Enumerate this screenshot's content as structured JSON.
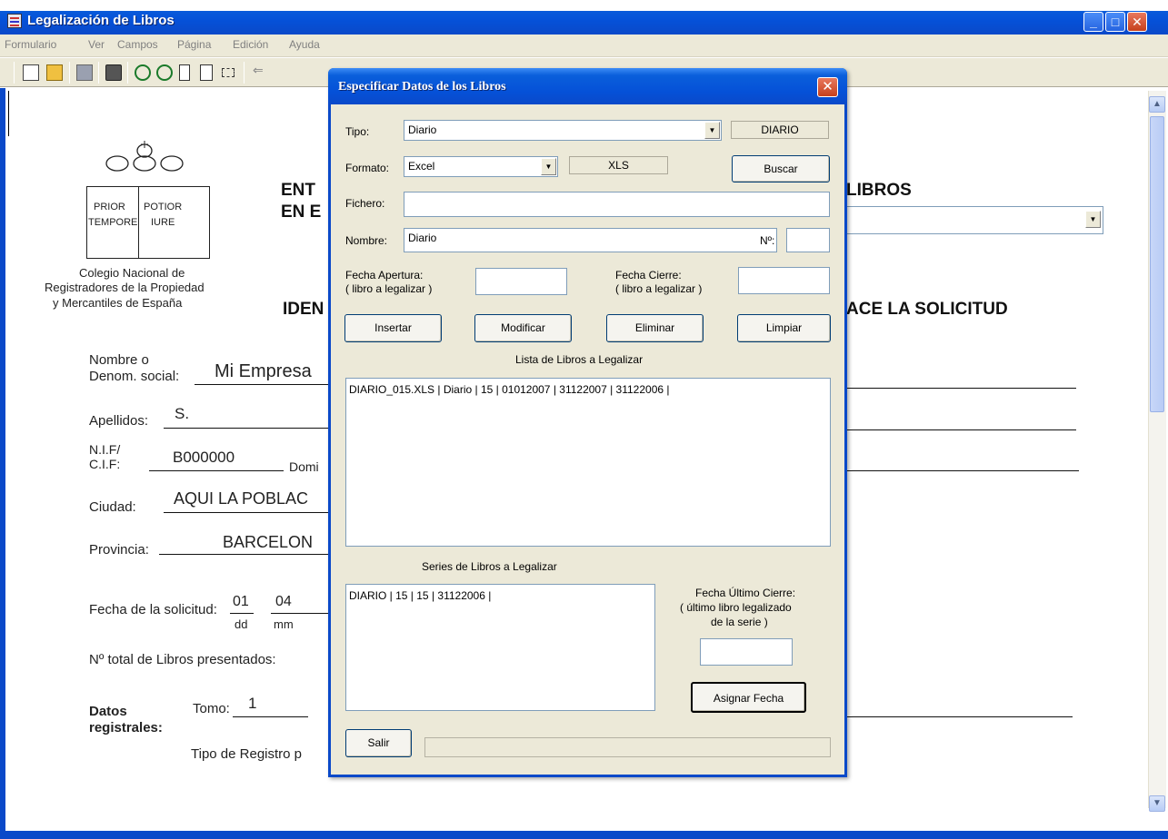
{
  "window": {
    "title": "Legalización de Libros",
    "minimize": "_",
    "maximize": "□",
    "close": "✕"
  },
  "menu": [
    "Formulario",
    "Ver",
    "Campos",
    "Página",
    "Edición",
    "Ayuda"
  ],
  "toolbar_icons": [
    "new-doc-icon",
    "open-folder-icon",
    "save-icon",
    "print-icon",
    "zoom-in-icon",
    "zoom-out-icon",
    "page-icon",
    "text-icon",
    "frame-icon",
    "back-arrow-icon"
  ],
  "document": {
    "logo": {
      "box_left_top": "PRIOR",
      "box_left_bottom": "TEMPORE",
      "box_right_top": "POTIOR",
      "box_right_bottom": "IURE",
      "caption_1": "Colegio Nacional de",
      "caption_2": "Registradores de la Propiedad",
      "caption_3": "y Mercantiles de España"
    },
    "heading_1_left": "ENT",
    "heading_1_right": "LIBROS",
    "heading_2_left": "EN E",
    "section_left": "IDEN",
    "section_right": "ACE LA SOLICITUD",
    "nombre_label_1": "Nombre o",
    "nombre_label_2": "Denom. social:",
    "nombre_value": "Mi Empresa",
    "apellidos_label": "Apellidos:",
    "apellidos_value": "S.",
    "nif_label_1": "N.I.F/",
    "nif_label_2": "C.I.F:",
    "nif_value": "B000000",
    "domicilio_label": "Domi",
    "ciudad_label": "Ciudad:",
    "ciudad_value": "AQUI LA POBLAC",
    "provincia_label": "Provincia:",
    "provincia_value": "BARCELON",
    "fecha_label": "Fecha de la solicitud:",
    "fecha_dd": "01",
    "fecha_mm": "04",
    "dd_label": "dd",
    "mm_label": "mm",
    "total_label": "Nº total de Libros presentados:",
    "datos_label_1": "Datos",
    "datos_label_2": "registrales:",
    "tomo_label": "Tomo:",
    "tomo_value": "1",
    "tipo_registro_label": "Tipo de Registro p"
  },
  "dialog": {
    "title": "Especificar Datos de los Libros",
    "close": "✕",
    "tipo_label": "Tipo:",
    "tipo_value": "Diario",
    "tipo_tag": "DIARIO",
    "formato_label": "Formato:",
    "formato_value": "Excel",
    "formato_tag": "XLS",
    "buscar": "Buscar",
    "fichero_label": "Fichero:",
    "fichero_value": "",
    "nombre_label": "Nombre:",
    "nombre_value": "Diario",
    "numero_label": "Nº:",
    "numero_value": "",
    "apertura_label_1": "Fecha Apertura:",
    "apertura_label_2": "( libro a legalizar )",
    "apertura_value": "",
    "cierre_label_1": "Fecha Cierre:",
    "cierre_label_2": "( libro a legalizar )",
    "cierre_value": "",
    "insertar": "Insertar",
    "modificar": "Modificar",
    "eliminar": "Eliminar",
    "limpiar": "Limpiar",
    "lista_title": "Lista de Libros a Legalizar",
    "lista_items": [
      "DIARIO_015.XLS | Diario | 15 | 01012007 | 31122007 | 31122006 |"
    ],
    "series_title": "Series de Libros a Legalizar",
    "series_items": [
      "DIARIO | 15 | 15 | 31122006 |"
    ],
    "ultimo_label_1": "Fecha Último Cierre:",
    "ultimo_label_2": "( último libro legalizado",
    "ultimo_label_3": "de la serie )",
    "ultimo_value": "",
    "asignar": "Asignar Fecha",
    "salir": "Salir"
  }
}
